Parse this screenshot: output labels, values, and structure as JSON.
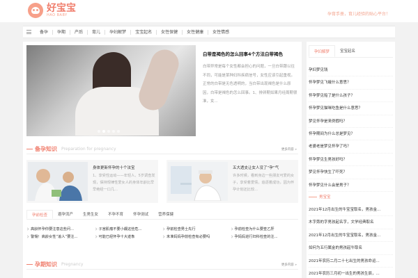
{
  "brand": {
    "name_cn": "好宝宝",
    "name_en": "HAO BABY",
    "slogan": "孕育手册，育儿经验的贴心平台！"
  },
  "nav": [
    "备孕",
    "孕期",
    "产后",
    "育儿",
    "孕妇解梦",
    "宝宝起名",
    "女性保健",
    "女性健康",
    "女性情感"
  ],
  "feature": {
    "title": "白带是褐色的怎么回事4个方法白带褐色",
    "text": "白带异常是每个女性都会担心的问题，一旦白带跟以往不同，可能是某种妇科疾病信号，女性应该引起重视。正常的白带是无色透明的，当白带出现褐色是什么原因，白带是褐色的怎么回事。1、排卵期如果月经周期很准，女..."
  },
  "section1": {
    "title": "备孕知识",
    "en": "Preparation for pregnancy",
    "more": "更多内容"
  },
  "cards": [
    {
      "title": "身体更新怀孕的十个法宝",
      "text": "1、享受性运动——年轻人、5岁调查发现，保持规律性爱女人的身体年龄比早早绝经一口几..."
    },
    {
      "title": "五大透支让女人没了“孕”气",
      "text": "许多时候，看到身边一些朋友可爱的女子，享受着爱情，追逐着成功，因为怀孕计划还比较..."
    }
  ],
  "tabs": [
    "孕前检查",
    "避孕流产",
    "生男生女",
    "不孕不育",
    "怀孕测试",
    "营养保健"
  ],
  "links": [
    "高龄怀孕你要注意这些问...",
    "子宫肌瘤不要小觑这些危...",
    "孕前检查男士先行",
    "孕前检查为什么要查乙肝",
    "警惕！高龄女性“追人”要注...",
    "可能已经怀孕十大迹象",
    "未准妈妈孕前检查有必要吗",
    "孕妈妈进行妇科检查的注..."
  ],
  "section2": {
    "title": "孕期知识",
    "en": "Pregnancy",
    "more": "更多内容"
  },
  "side_tabs": [
    "孕妇解梦",
    "宝宝起名"
  ],
  "side_list": [
    "孕妇梦见钱",
    "怀孕梦见飞蛾什么意思？",
    "怀孕梦见船了是什么孩子？",
    "怀孕梦见猫咪吃鱼是什么意思？",
    "梦见怀孕是来例假吗？",
    "怀孕期间为什么总是梦见？",
    "老婆老是梦见怀孕了吗？",
    "怀孕梦见生男孩好吗？",
    "梦见怀孕快生了吓死？",
    "怀孕梦见什么会是男子？"
  ],
  "side_section": "男宝宝",
  "side_list2": [
    "2021年12月出生的牛宝宝取名，男孩金...",
    "木字旁的字男孩起名字，文学经典取名",
    "2021年12月出生的牛宝宝取名，男孩金...",
    "如何为五行属金的男孩起牛取名",
    "2021年农历二月二十七出生的男孩命运...",
    "2021年农历三月初一出生的男孩生辰，..."
  ]
}
